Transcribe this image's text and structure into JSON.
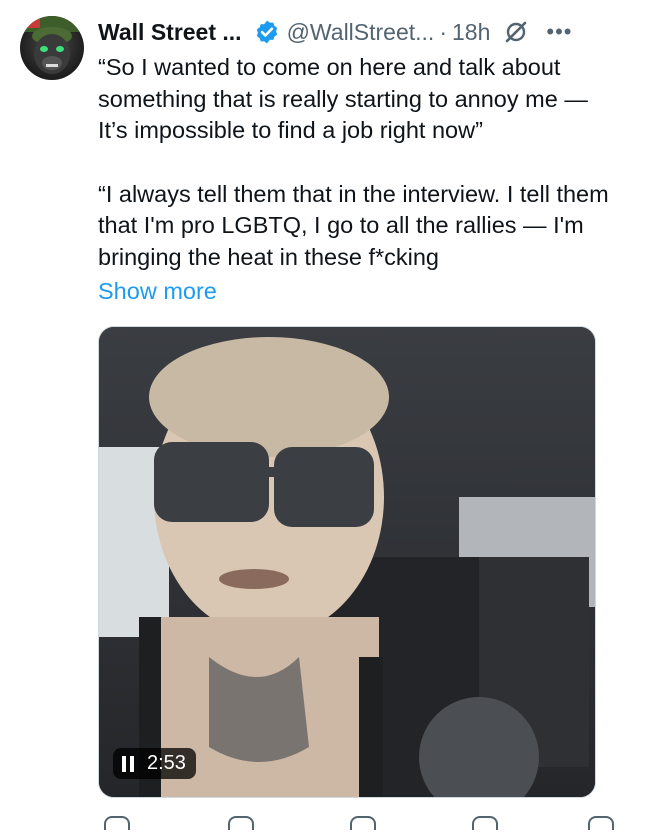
{
  "author": {
    "name": "Wall Street ...",
    "handle": "@WallStreet...",
    "time": "18h",
    "separator": "·"
  },
  "tweet": {
    "paragraph1": "“So I wanted to come on here and talk about something that is really starting to annoy me — It’s impossible to find a job right now”",
    "paragraph2": "“I always tell them that in the interview. I tell them that I'm pro LGBTQ, I go to all the rallies — I'm bringing the heat in these f*cking",
    "show_more": "Show more"
  },
  "video": {
    "duration": "2:53",
    "state": "playing"
  },
  "icons": {
    "verified": "verified-badge-icon",
    "grok": "grok-icon",
    "more": "more-options-icon",
    "pause": "pause-icon"
  },
  "colors": {
    "link": "#1d9bf0",
    "secondary": "#536471",
    "verified": "#1d9bf0"
  }
}
